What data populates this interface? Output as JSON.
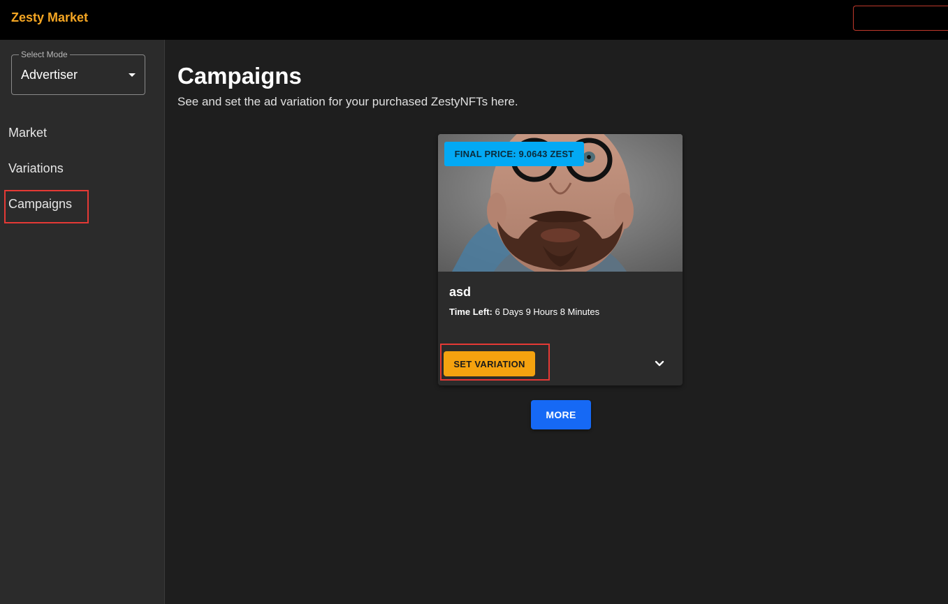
{
  "header": {
    "brand": "Zesty Market"
  },
  "sidebar": {
    "mode_label": "Select Mode",
    "mode_value": "Advertiser",
    "items": [
      {
        "label": "Market"
      },
      {
        "label": "Variations"
      },
      {
        "label": "Campaigns"
      }
    ]
  },
  "main": {
    "title": "Campaigns",
    "subtitle": "See and set the ad variation for your purchased ZestyNFTs here."
  },
  "card": {
    "price_badge": "FINAL PRICE: 9.0643 ZEST",
    "title": "asd",
    "time_left_label": "Time Left:",
    "time_left_value": " 6 Days 9 Hours 8 Minutes",
    "set_variation_label": "SET VARIATION",
    "expand_icon": "chevron-down-icon"
  },
  "more_label": "MORE",
  "colors": {
    "brand": "#f5a623",
    "badge": "#03a9f4",
    "set_variation": "#f5a20f",
    "more": "#1669f5",
    "highlight": "#e53935"
  }
}
